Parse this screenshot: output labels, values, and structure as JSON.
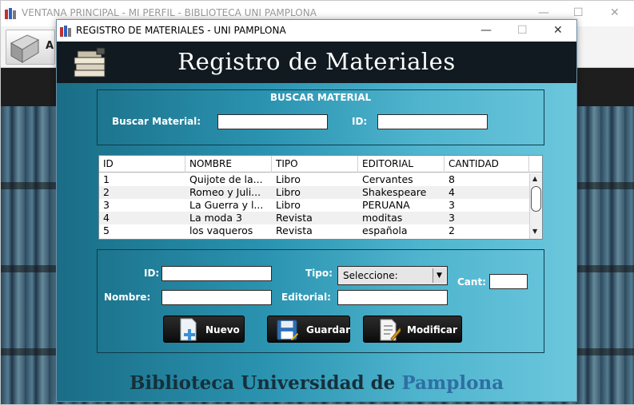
{
  "back_window": {
    "title": "VENTANA PRINCIPAL - MI PERFIL - BIBLIOTECA UNI PAMPLONA",
    "toolbar_label": "A"
  },
  "dialog": {
    "title": "REGISTRO DE MATERIALES - UNI PAMPLONA",
    "header_title": "Registro de Materiales",
    "search": {
      "heading": "BUSCAR MATERIAL",
      "material_label": "Buscar Material:",
      "material_value": "",
      "id_label": "ID:",
      "id_value": ""
    },
    "table": {
      "columns": [
        "ID",
        "NOMBRE",
        "TIPO",
        "EDITORIAL",
        "CANTIDAD"
      ],
      "rows": [
        [
          "1",
          "Quijote de la...",
          "Libro",
          "Cervantes",
          "8"
        ],
        [
          "2",
          "Romeo y Juli...",
          "Libro",
          "Shakespeare",
          "4"
        ],
        [
          "3",
          "La Guerra y l...",
          "Libro",
          "PERUANA",
          "3"
        ],
        [
          "4",
          "La moda 3",
          "Revista",
          "moditas",
          "3"
        ],
        [
          "5",
          "los vaqueros",
          "Revista",
          "española",
          "2"
        ]
      ]
    },
    "form": {
      "id_label": "ID:",
      "id_value": "",
      "nombre_label": "Nombre:",
      "nombre_value": "",
      "tipo_label": "Tipo:",
      "tipo_selected": "Seleccione:",
      "editorial_label": "Editorial:",
      "editorial_value": "",
      "cant_label": "Cant:",
      "cant_value": ""
    },
    "buttons": {
      "nuevo": "Nuevo",
      "guardar": "Guardar",
      "modificar": "Modificar"
    },
    "footer": {
      "part1": "Biblioteca Universidad de ",
      "part2": "Pamplona"
    }
  },
  "colors": {
    "header_band": "#101a20",
    "panel_gradient_start": "#1a6d86",
    "panel_gradient_end": "#6bc7dc",
    "button_bg": "#111111"
  },
  "icons": [
    "app-books-icon",
    "minimize-icon",
    "maximize-icon",
    "close-icon",
    "books-stack-icon",
    "new-document-icon",
    "floppy-save-icon",
    "edit-document-icon"
  ]
}
